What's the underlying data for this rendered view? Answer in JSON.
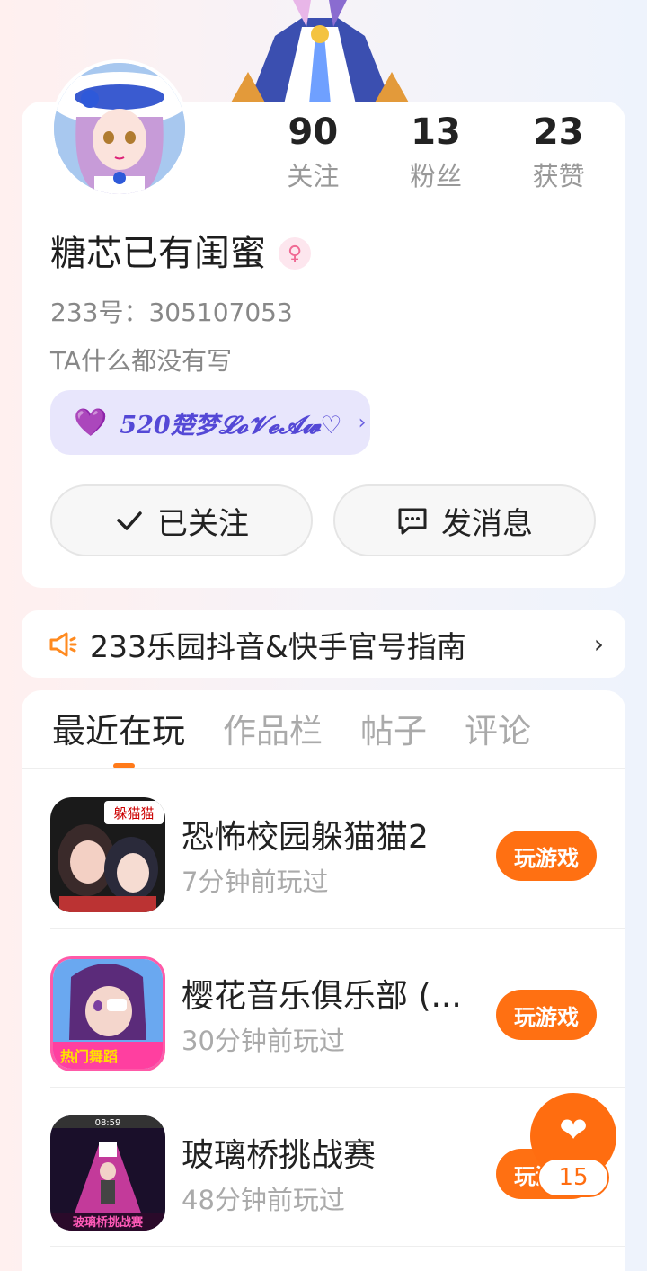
{
  "colors": {
    "accent": "#ff7012",
    "guild_bg": "#e8e6fc",
    "guild_text": "#5448d6",
    "gender": "#f06a94"
  },
  "profile": {
    "name": "糖芯已有闺蜜",
    "uid": "233号：305107053",
    "bio": "TA什么都没有写",
    "gender_icon": "female-icon",
    "stats": [
      {
        "value": "90",
        "label": "关注"
      },
      {
        "value": "13",
        "label": "粉丝"
      },
      {
        "value": "23",
        "label": "获赞"
      }
    ],
    "guild_tag": "520楚梦𝓛𝓸𝓥𝓮𝓐𝔀♡",
    "follow_button": "已关注",
    "message_button": "发消息"
  },
  "notice": {
    "text": "233乐园抖音&快手官号指南"
  },
  "tabs": [
    {
      "label": "最近在玩",
      "active": true
    },
    {
      "label": "作品栏",
      "active": false
    },
    {
      "label": "帖子",
      "active": false
    },
    {
      "label": "评论",
      "active": false
    }
  ],
  "games": [
    {
      "title": "恐怖校园躲猫猫2",
      "time": "7分钟前玩过",
      "button": "玩游戏",
      "icon_text": "躲猫猫"
    },
    {
      "title": "樱花音乐俱乐部 (...",
      "time": "30分钟前玩过",
      "button": "玩游戏",
      "icon_text": "热门舞蹈"
    },
    {
      "title": "玻璃桥挑战赛",
      "time": "48分钟前玩过",
      "button": "玩游戏",
      "icon_text": "玻璃桥挑战赛",
      "icon_timer": "08:59"
    }
  ],
  "fab": {
    "count": "15"
  }
}
